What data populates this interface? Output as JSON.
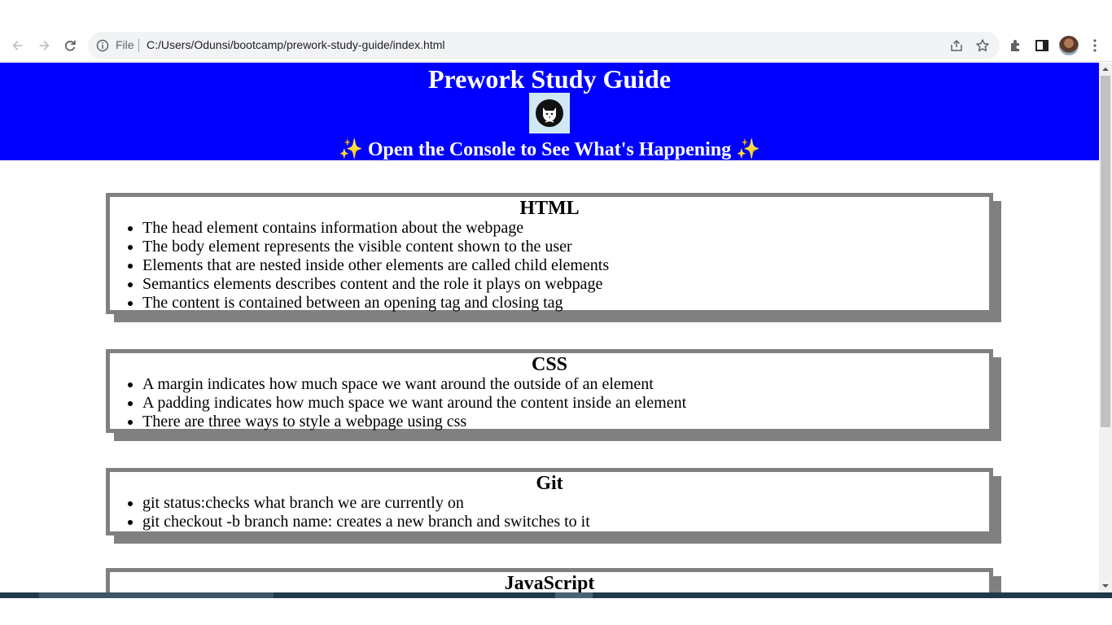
{
  "browser": {
    "scheme_chip": "File",
    "url": "C:/Users/Odunsi/bootcamp/prework-study-guide/index.html",
    "icons": [
      "back-arrow-icon",
      "forward-arrow-icon",
      "reload-icon",
      "info-icon",
      "share-icon",
      "star-icon",
      "extensions-icon",
      "side-panel-icon",
      "avatar",
      "kebab-menu-icon"
    ]
  },
  "page": {
    "title": "Prework Study Guide",
    "subtitle": "Open the Console to See What's Happening",
    "sparkle": "✨",
    "header_bg": "#0000ff",
    "card_border": "#808080",
    "sections": [
      {
        "heading": "HTML",
        "items": [
          "The head element contains information about the webpage",
          "The body element represents the visible content shown to the user",
          "Elements that are nested inside other elements are called child elements",
          "Semantics elements describes content and the role it plays on webpage",
          "The content is contained between an opening tag and closing tag"
        ]
      },
      {
        "heading": "CSS",
        "items": [
          "A margin indicates how much space we want around the outside of an element",
          "A padding indicates how much space we want around the content inside an element",
          "There are three ways to style a webpage using css"
        ]
      },
      {
        "heading": "Git",
        "items": [
          "git status:checks what branch we are currently on",
          "git checkout -b branch name: creates a new branch and switches to it"
        ]
      },
      {
        "heading": "JavaScript",
        "items": []
      }
    ]
  }
}
